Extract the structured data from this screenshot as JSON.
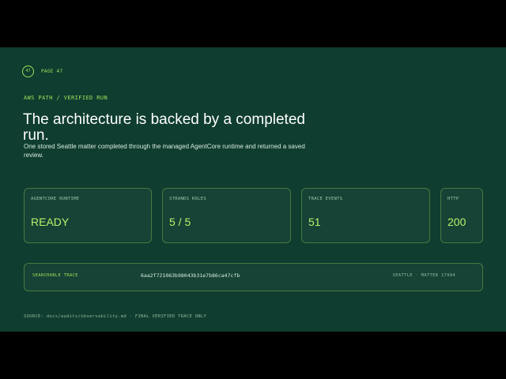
{
  "header": {
    "page_number": "47",
    "page_label": "PAGE 47",
    "eyebrow": "AWS PATH / VERIFIED RUN"
  },
  "title": "The architecture is backed by a completed run.",
  "subtitle": "One stored Seattle matter completed through the managed AgentCore runtime and returned a saved review.",
  "cards": [
    {
      "label": "AGENTCORE RUNTIME",
      "value": "READY"
    },
    {
      "label": "STRANDS ROLES",
      "value": "5 / 5"
    },
    {
      "label": "TRACE EVENTS",
      "value": "51"
    },
    {
      "label": "HTTP",
      "value": "200"
    }
  ],
  "trace": {
    "label": "SEARCHABLE TRACE",
    "id": "6aa2f721063b98043b31e7b86ca47cfb",
    "meta": "SEATTLE · MATTER 17994"
  },
  "footer": {
    "source": "SOURCE: docs/audits/observability.md · FINAL VERIFIED TRACE ONLY"
  },
  "colors": {
    "background": "#0f3d2f",
    "accent": "#9be35d",
    "value": "#b8f06a",
    "letterbox": "#000000"
  }
}
